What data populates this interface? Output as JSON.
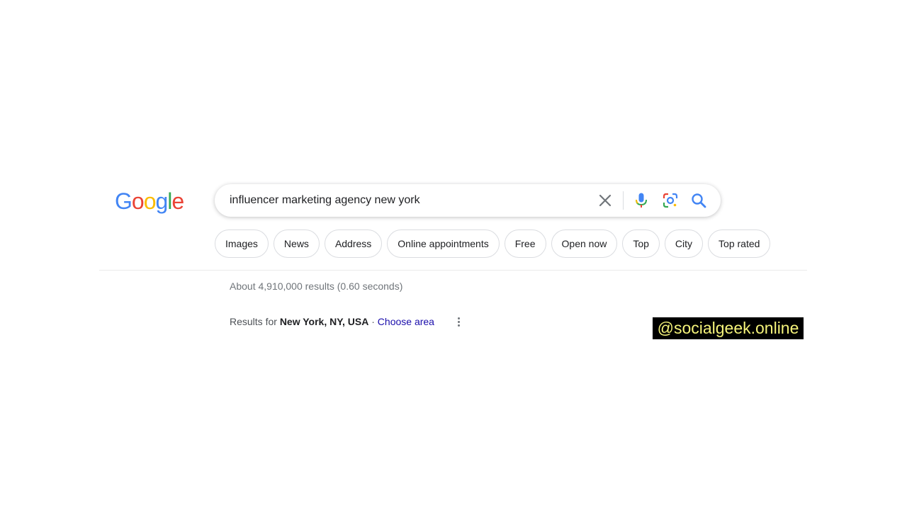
{
  "logo": {
    "letters": [
      "G",
      "o",
      "o",
      "g",
      "l",
      "e"
    ],
    "colors": [
      "#4285F4",
      "#EA4335",
      "#FBBC05",
      "#4285F4",
      "#34A853",
      "#EA4335"
    ]
  },
  "search": {
    "query": "influencer marketing agency new york",
    "icons": [
      "close-icon",
      "mic-icon",
      "lens-icon",
      "search-icon"
    ]
  },
  "chips": [
    {
      "label": "Images"
    },
    {
      "label": "News"
    },
    {
      "label": "Address"
    },
    {
      "label": "Online appointments"
    },
    {
      "label": "Free"
    },
    {
      "label": "Open now"
    },
    {
      "label": "Top"
    },
    {
      "label": "City"
    },
    {
      "label": "Top rated"
    }
  ],
  "results": {
    "stats": "About 4,910,000 results (0.60 seconds)"
  },
  "location": {
    "prefix": "Results for ",
    "name": "New York, NY, USA",
    "separator": " · ",
    "choose_area": "Choose area"
  },
  "watermark": {
    "text": "@socialgeek.online"
  },
  "colors": {
    "link": "#1a0dab",
    "chip_border": "#dadce0",
    "watermark_bg": "#000000",
    "watermark_text": "#f5f37a"
  }
}
